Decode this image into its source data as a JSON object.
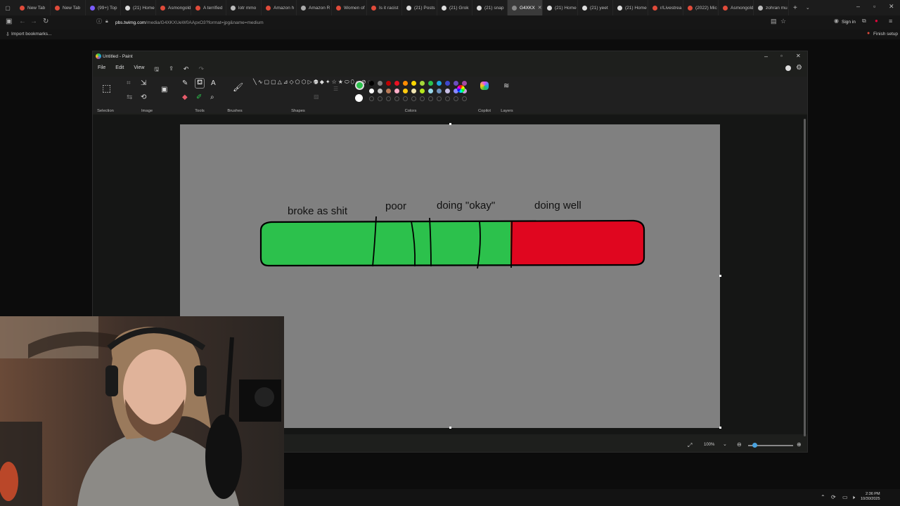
{
  "browser": {
    "tabs": [
      {
        "label": "New Tab",
        "color": "#e04b3a"
      },
      {
        "label": "New Tab",
        "color": "#e04b3a"
      },
      {
        "label": "(99+) Top",
        "color": "#7b5cff"
      },
      {
        "label": "(21) Home",
        "color": "#dddddd"
      },
      {
        "label": "Asmongold",
        "color": "#e04b3a"
      },
      {
        "label": "A terrified",
        "color": "#e04b3a"
      },
      {
        "label": "lotr mmo",
        "color": "#bbbbbb"
      },
      {
        "label": "Amazon h",
        "color": "#e04b3a"
      },
      {
        "label": "Amazon R",
        "color": "#aaaaaa"
      },
      {
        "label": "Women of",
        "color": "#e04b3a"
      },
      {
        "label": "Is it racist",
        "color": "#e04b3a"
      },
      {
        "label": "(21) Posts",
        "color": "#dddddd"
      },
      {
        "label": "(21) Grok",
        "color": "#dddddd"
      },
      {
        "label": "(21) snap",
        "color": "#dddddd"
      },
      {
        "label": "G4XKX",
        "color": "#888888"
      },
      {
        "label": "(21) Home",
        "color": "#dddddd"
      },
      {
        "label": "(21) yeet",
        "color": "#dddddd"
      },
      {
        "label": "(21) Home",
        "color": "#dddddd"
      },
      {
        "label": "r/Livestrea",
        "color": "#e04b3a"
      },
      {
        "label": "(2022) Mic",
        "color": "#e04b3a"
      },
      {
        "label": "Asmongold",
        "color": "#e04b3a"
      },
      {
        "label": "zohran mu",
        "color": "#bbbbbb"
      }
    ],
    "active_tab_index": 14,
    "url_host": "pbs.twimg.com",
    "url_path": "/media/G4XKXUeW0AApxO3?format=jpg&name=medium",
    "sign_in": "Sign in",
    "finish_setup": "Finish setup",
    "import_bookmarks": "Import bookmarks..."
  },
  "paint": {
    "title": "Untitled - Paint",
    "menu": [
      "File",
      "Edit",
      "View"
    ],
    "groups": [
      "Selection",
      "Image",
      "Tools",
      "Brushes",
      "Shapes",
      "Colors",
      "Copilot",
      "Layers"
    ],
    "primary_color": "#2cc14c",
    "secondary_color": "#ffffff",
    "palette_row1": [
      "#000000",
      "#7f7f7f",
      "#c00000",
      "#e81123",
      "#ff8c00",
      "#ffd700",
      "#a4d73b",
      "#2cc14c",
      "#1fa7e1",
      "#3f48cc",
      "#6b4ebf",
      "#a349a4"
    ],
    "palette_row2": [
      "#ffffff",
      "#c3c3c3",
      "#b97a57",
      "#ffaec9",
      "#ffc90e",
      "#efe4b0",
      "#b5e61d",
      "#99d9ea",
      "#7092be",
      "#c8bfe7",
      "#8a8aff",
      "#c9a0dc"
    ],
    "zoom": "100%",
    "drawing": {
      "labels": [
        "broke as shit",
        "poor",
        "doing \"okay\"",
        "doing well"
      ],
      "green": "#2cc14c",
      "red": "#e0061f"
    }
  },
  "taskbar": {
    "time": "2:36 PM",
    "date": "10/30/2025"
  }
}
